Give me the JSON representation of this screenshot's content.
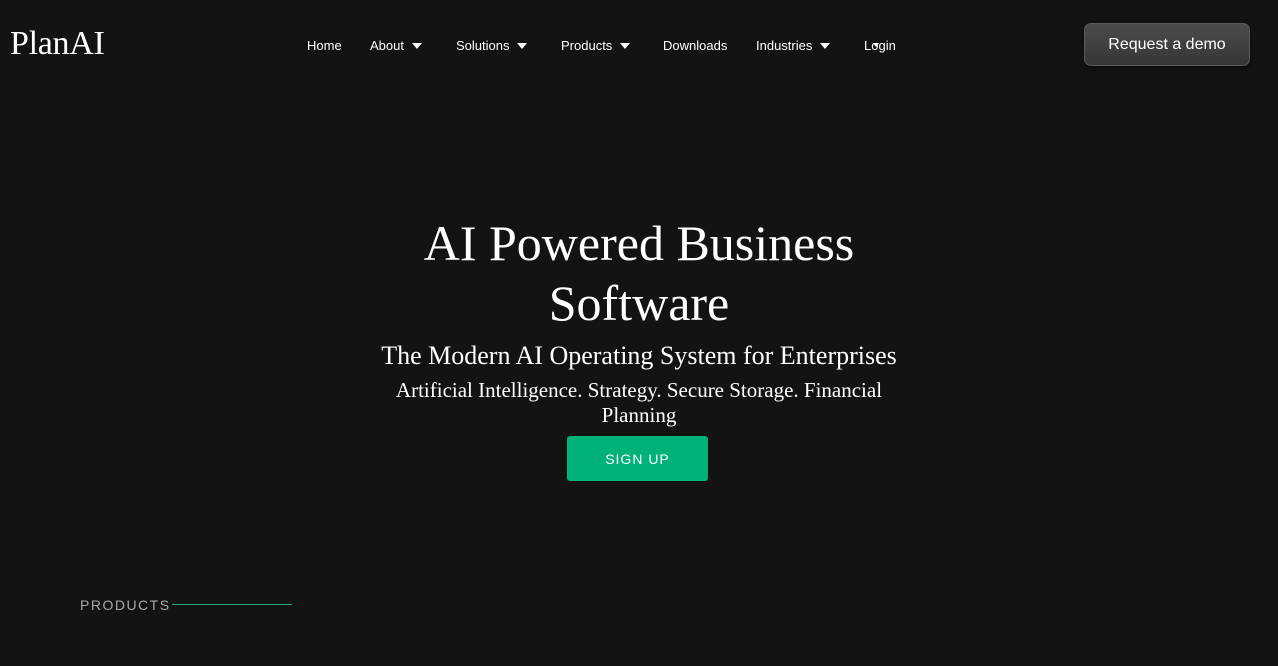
{
  "header": {
    "logo": "PlanAI",
    "nav": [
      {
        "label": "Home",
        "dropdown": false
      },
      {
        "label": "About",
        "dropdown": true
      },
      {
        "label": "Solutions",
        "dropdown": true
      },
      {
        "label": "Products",
        "dropdown": true
      },
      {
        "label": "Downloads",
        "dropdown": false
      },
      {
        "label": "Industries",
        "dropdown": true
      },
      {
        "label": "Login",
        "dropdown": false
      }
    ],
    "cta": "Request a demo"
  },
  "hero": {
    "title_line1": "AI Powered Business",
    "title_line2": "Software",
    "subtitle": "The Modern AI Operating System for Enterprises",
    "tagline": "Artificial Intelligence. Strategy. Secure Storage. Financial Planning",
    "signup": "SIGN UP"
  },
  "products": {
    "label": "PRODUCTS"
  },
  "colors": {
    "background": "#131313",
    "accent": "#00b27a",
    "button": "#404040"
  }
}
